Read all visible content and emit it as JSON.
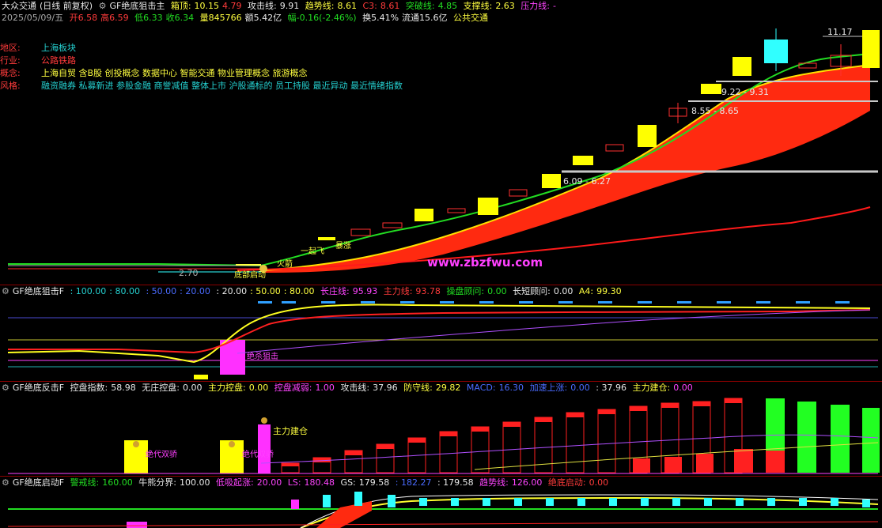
{
  "colors": {
    "bg": "#000000",
    "red": "#ff2020",
    "yellow": "#ffff00",
    "cyan": "#30ffff",
    "green": "#22dd22",
    "magenta": "#ff30ff",
    "white": "#e0e0e0"
  },
  "main": {
    "name": "大众交通",
    "mode": "(日线 前复权)",
    "indicator": "GF绝底狙击主",
    "box_top_label": "箱顶:",
    "box_top": "10.15",
    "box_top_b": "4.79",
    "attack_label": "攻击线:",
    "attack": "9.91",
    "trend_label": "趋势线:",
    "trend": "8.61",
    "c3_label": "C3:",
    "c3": "8.61",
    "breakout_label": "突破线:",
    "breakout": "4.85",
    "support_label": "支撑线:",
    "support": "2.63",
    "pressure_label": "压力线:",
    "pressure": "-",
    "date": "2025/05/09/五",
    "open": "开6.58",
    "high": "高6.59",
    "low": "低6.33",
    "close": "收6.34",
    "volume": "量845766",
    "amount": "额5.42亿",
    "change": "幅-0.16(-2.46%)",
    "turnover": "换5.41%",
    "float_cap": "流通15.6亿",
    "company": "公共交通",
    "info": [
      {
        "key": "地区:",
        "value": "上海板块"
      },
      {
        "key": "行业:",
        "value": "公路铁路"
      },
      {
        "key": "概念:",
        "value": "上海自贸 含B股 创投概念 数据中心 智能交通 物业管理概念 旅游概念"
      },
      {
        "key": "风格:",
        "value": "融资融券 私募新进 参股金融 商誉减值 整体上市 沪股通标的 员工持股 最近异动 最近情绪指数"
      }
    ],
    "price_annotations": [
      "11.17",
      "9.22 - 9.31",
      "8.55 - 8.65",
      "6.09 - 6.27",
      "2.70"
    ],
    "markers": [
      "一起飞",
      "暴涨",
      "火箭",
      "底部启动"
    ],
    "watermark": "www.zbzfwu.com"
  },
  "panel2": {
    "indicator": "GF绝底狙击F",
    "levels": [
      ": 100.00",
      ": 80.00",
      ": 50.00",
      ": 20.00",
      ": 20.00",
      ": 50.00",
      ": 80.00"
    ],
    "long_label": "长庄线:",
    "long": "95.93",
    "main_label": "主力线:",
    "main": "93.78",
    "op_label": "操盘顾问:",
    "op": "0.00",
    "st_label": "长短顾问:",
    "st": "0.00",
    "a4_label": "A4:",
    "a4": "99.30",
    "mark_text": "绝杀狙击"
  },
  "panel3": {
    "indicator": "GF绝底反击F",
    "ctrl_label": "控盘指数:",
    "ctrl": "58.98",
    "noctrl_label": "无庄控盘:",
    "noctrl": "0.00",
    "mainctrl_label": "主力控盘:",
    "mainctrl": "0.00",
    "reduce_label": "控盘减弱:",
    "reduce": "1.00",
    "attack_label": "攻击线:",
    "attack": "37.96",
    "defend_label": "防守线:",
    "defend": "29.82",
    "macd_label": "MACD:",
    "macd": "16.30",
    "accel_label": "加速上涨:",
    "accel": "0.00",
    "v1": ": 37.96",
    "build_label": "主力建仓:",
    "build": "0.00",
    "mark_era": "绝代双骄",
    "mark_build": "主力建仓"
  },
  "panel4": {
    "indicator": "GF绝底启动F",
    "warn_label": "警戒线:",
    "warn": "160.00",
    "bull_label": "牛熊分界:",
    "bull": "100.00",
    "low_label": "低吸起涨:",
    "low": "20.00",
    "ls_label": "LS:",
    "ls": "180.48",
    "gs_label": "GS:",
    "gs": "179.58",
    "v1": ": 182.27",
    "v2": ": 179.58",
    "trend_label": "趋势线:",
    "trend": "126.00",
    "start_label": "绝底启动:",
    "start": "0.00"
  }
}
